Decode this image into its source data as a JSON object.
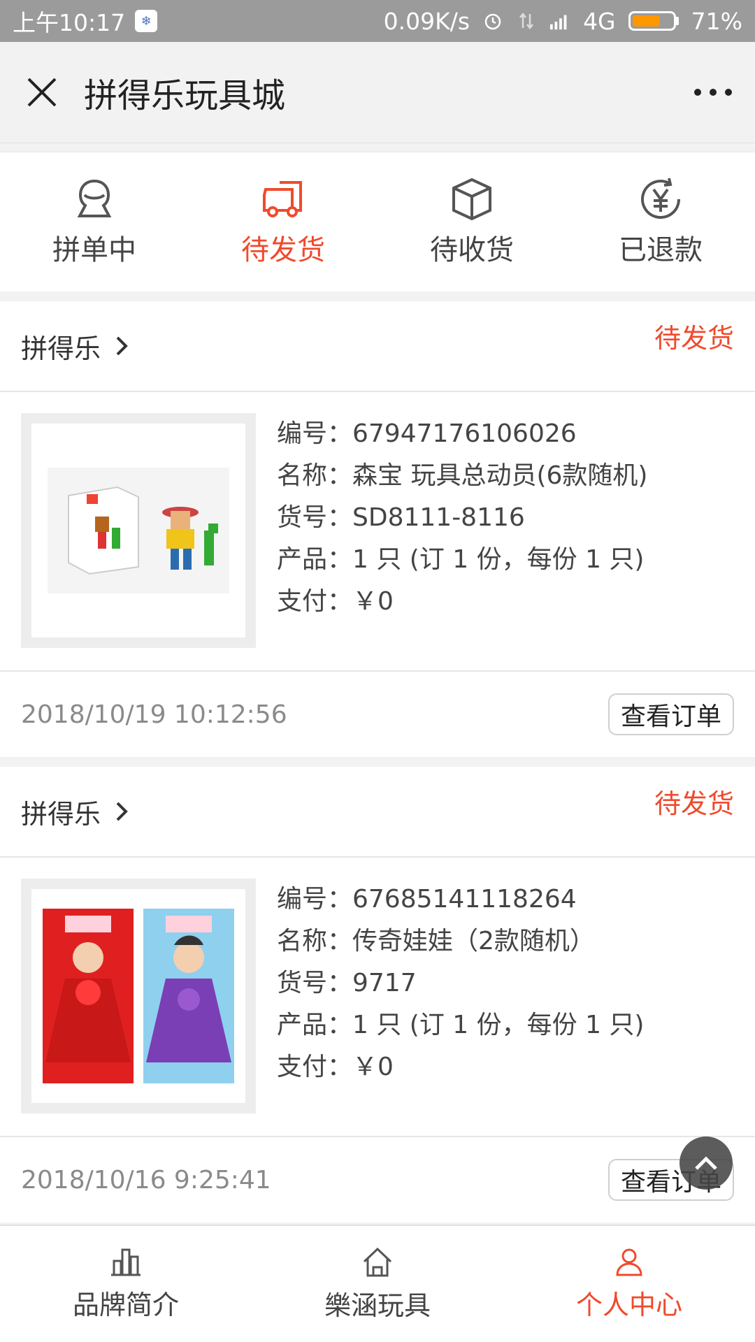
{
  "status_bar": {
    "time": "上午10:17",
    "speed": "0.09K/s",
    "network": "4G",
    "battery": "71%",
    "battery_level": 0.71
  },
  "header": {
    "title": "拼得乐玩具城"
  },
  "tabs": [
    {
      "label": "拼单中",
      "icon": "user-group-icon",
      "active": false
    },
    {
      "label": "待发货",
      "icon": "truck-icon",
      "active": true
    },
    {
      "label": "待收货",
      "icon": "box-icon",
      "active": false
    },
    {
      "label": "已退款",
      "icon": "yen-refund-icon",
      "active": false
    }
  ],
  "orders": [
    {
      "shop": "拼得乐",
      "status": "待发货",
      "lines": [
        "编号：67947176106026",
        "名称：森宝 玩具总动员(6款随机)",
        "货号：SD8111-8116",
        "产品：1 只 (订 1 份，每份 1 只)",
        "支付：￥0"
      ],
      "time": "2018/10/19 10:12:56",
      "button": "查看订单"
    },
    {
      "shop": "拼得乐",
      "status": "待发货",
      "lines": [
        "编号：67685141118264",
        "名称：传奇娃娃（2款随机）",
        "货号：9717",
        "产品：1 只 (订 1 份，每份 1 只)",
        "支付：￥0"
      ],
      "time": "2018/10/16 9:25:41",
      "button": "查看订单"
    }
  ],
  "bottom_nav": [
    {
      "label": "品牌简介",
      "icon": "bar-chart-icon",
      "active": false
    },
    {
      "label": "樂涵玩具",
      "icon": "home-icon",
      "active": false
    },
    {
      "label": "个人中心",
      "icon": "person-icon",
      "active": true
    }
  ],
  "colors": {
    "accent": "#f04a2d",
    "status_bar": "#9b9b9b",
    "battery": "#ff9800"
  }
}
